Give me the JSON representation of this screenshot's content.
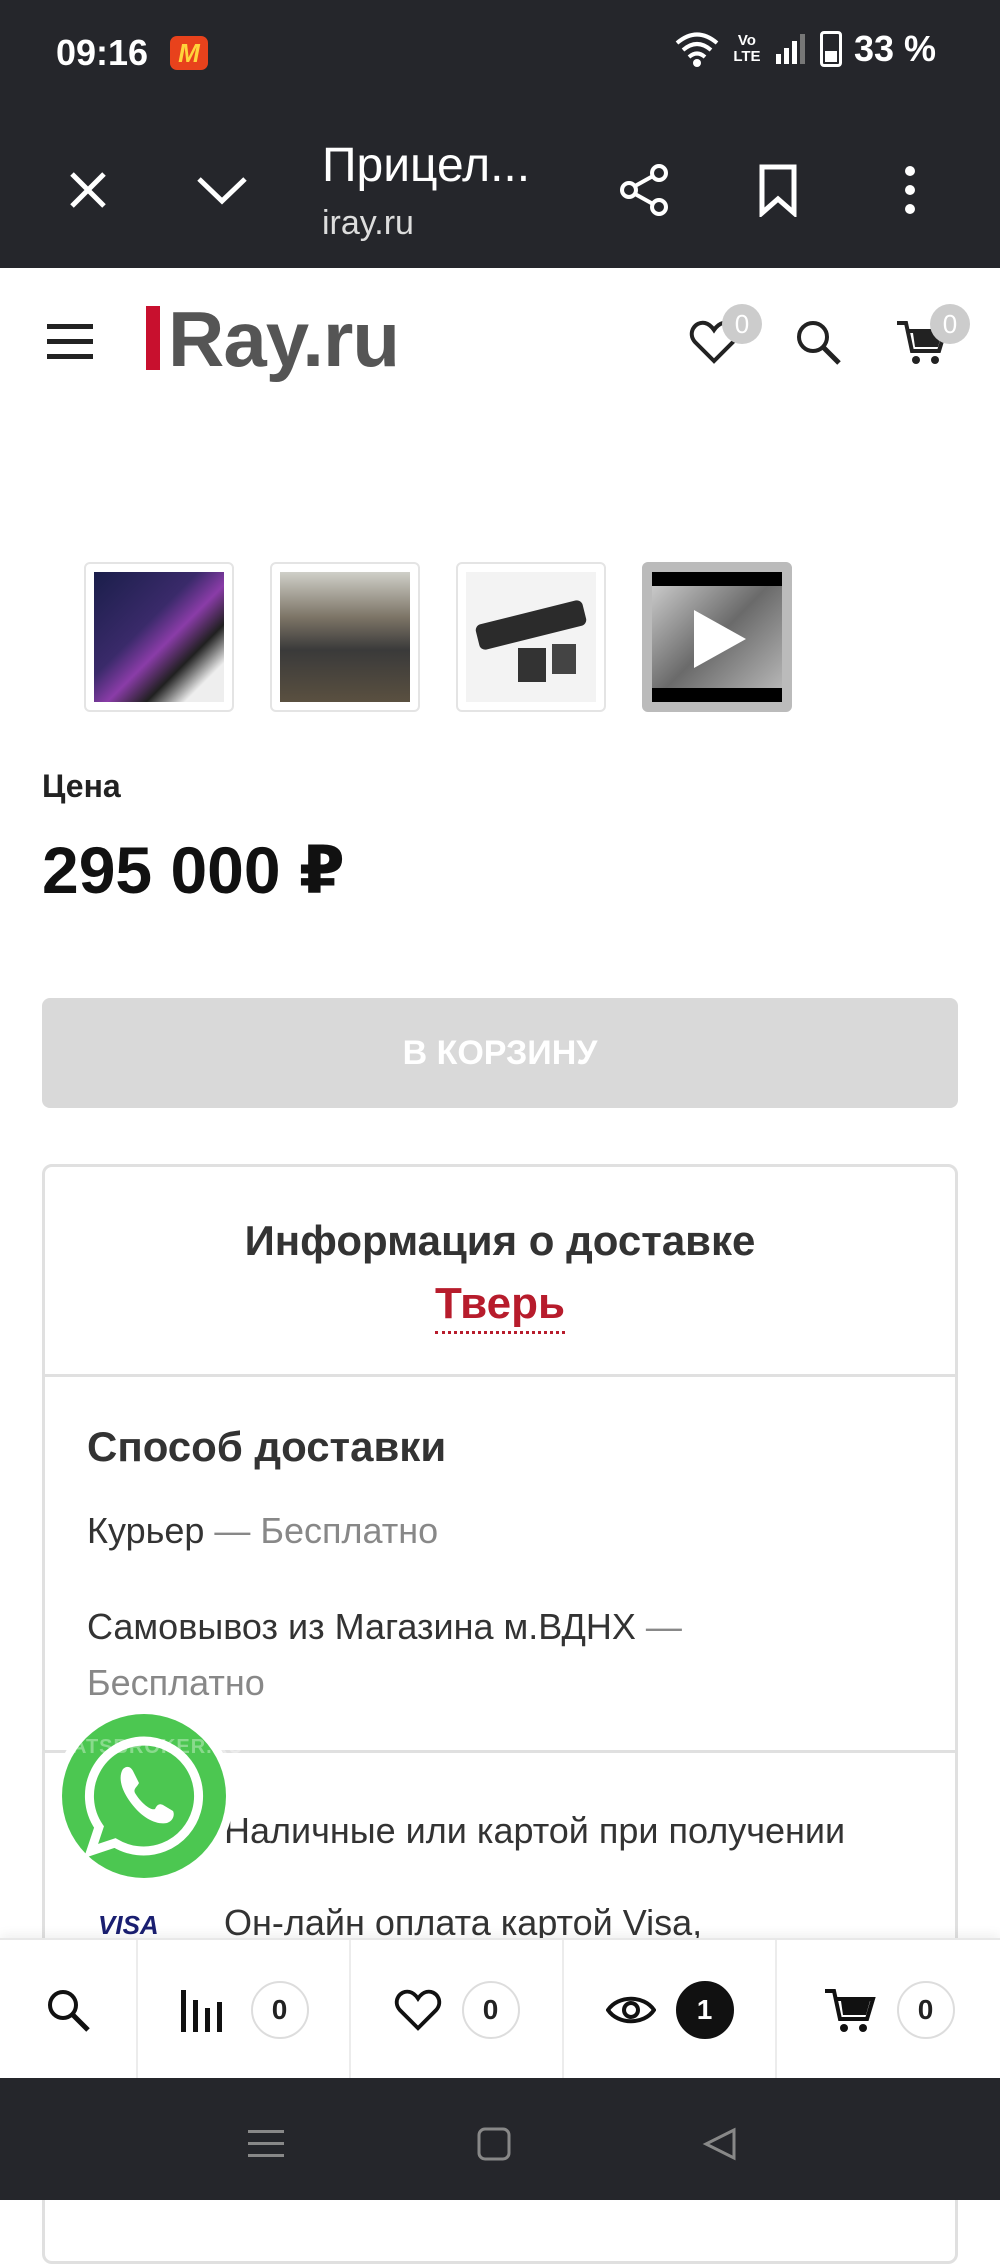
{
  "status_bar": {
    "time": "09:16",
    "app_icon_glyph": "M",
    "volte": "Vo LTE",
    "battery": "33 %"
  },
  "browser": {
    "title": "Прицел...",
    "url": "iray.ru",
    "icons": [
      "close-icon",
      "chevron-down-icon",
      "share-icon",
      "bookmark-icon",
      "more-vert-icon"
    ]
  },
  "header": {
    "logo_text": "Ray.ru",
    "wishlist_count": "0",
    "cart_count": "0"
  },
  "gallery": {
    "thumbnails": [
      "thumbnail-1",
      "thumbnail-2",
      "thumbnail-3",
      "video-thumbnail"
    ]
  },
  "product": {
    "price_label": "Цена",
    "price": "295 000 ₽",
    "add_to_cart": "В КОРЗИНУ"
  },
  "delivery": {
    "title": "Информация о доставке",
    "city": "Тверь",
    "method_title": "Способ доставки",
    "options": [
      {
        "name": "Курьер",
        "sep": " — ",
        "price": "Бесплатно"
      },
      {
        "name": "Самовывоз из Магазина м.ВДНХ",
        "sep": " — ",
        "price": "Бесплатно"
      }
    ],
    "payments": [
      "Наличные или картой при получении",
      "Он-лайн оплата картой Visa,"
    ],
    "visa_logo": "VISA"
  },
  "whatsapp": {
    "watermark": "ATSBROKER.RU"
  },
  "bottom_nav": {
    "compare_count": "0",
    "favorites_count": "0",
    "viewed_count": "1",
    "cart_count": "0"
  },
  "colors": {
    "brand_red": "#c8102e",
    "city_red": "#b71c2c",
    "whatsapp_green": "#4cc751",
    "chrome_dark": "#25262b"
  }
}
